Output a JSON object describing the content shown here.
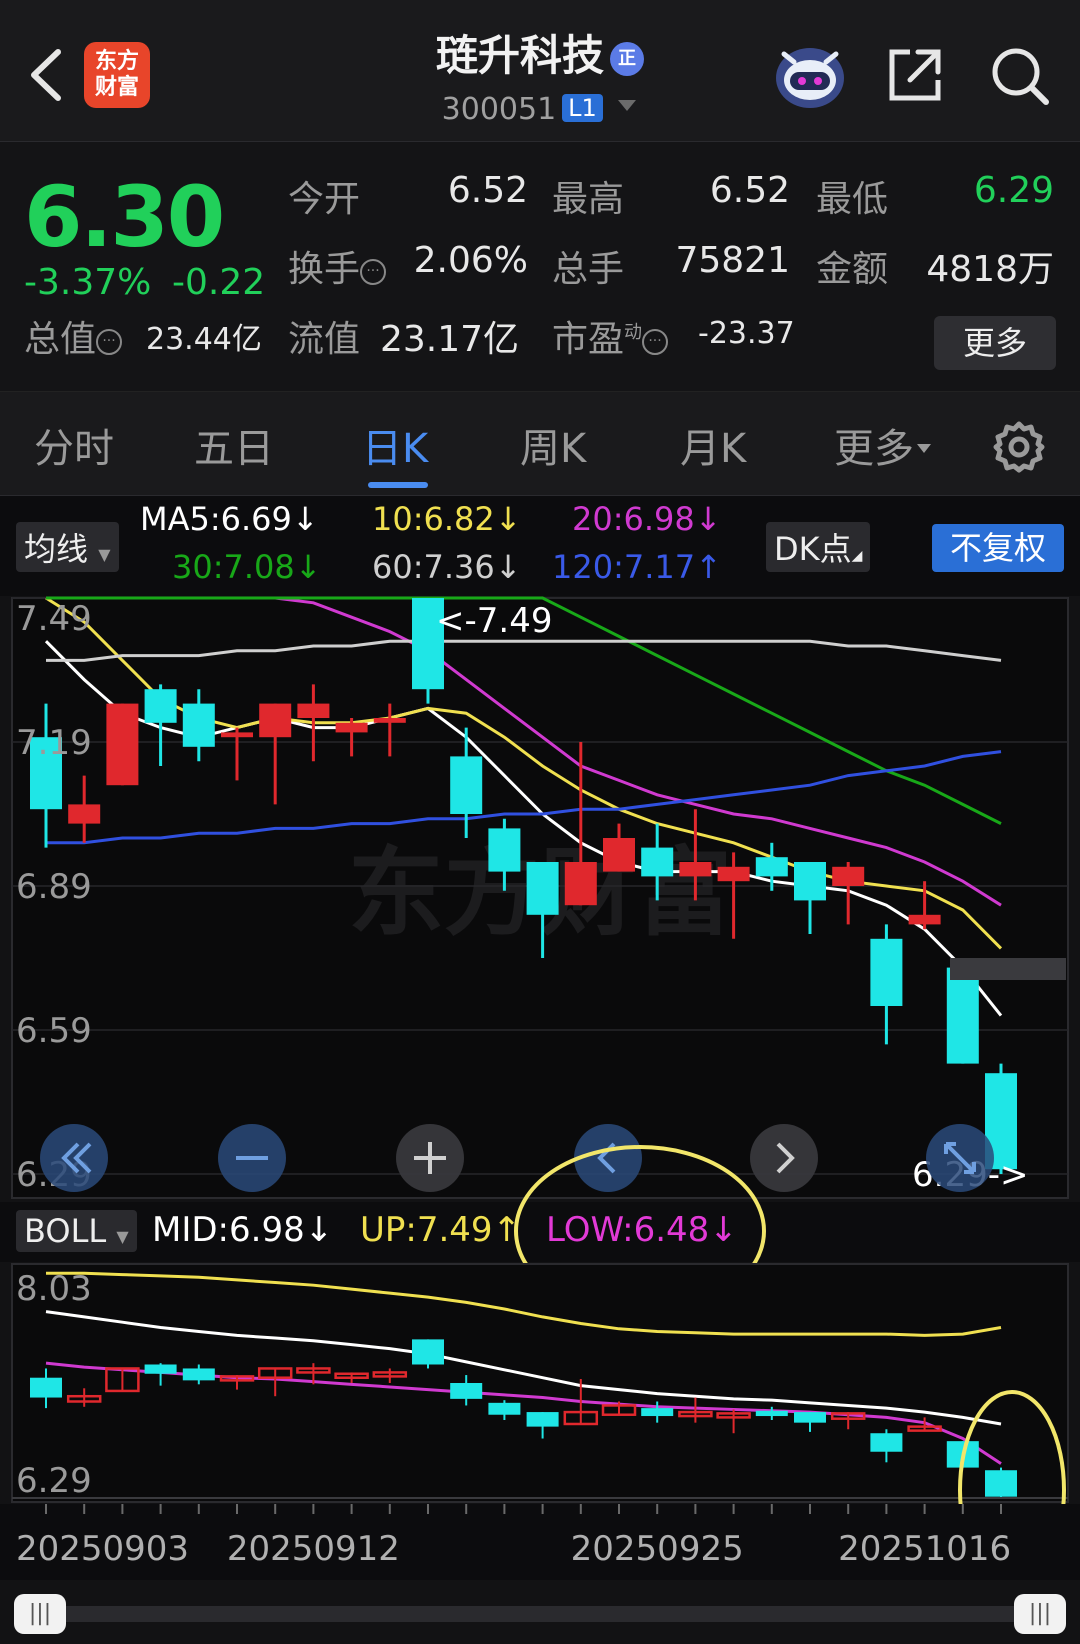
{
  "header": {
    "title": "琏升科技",
    "title_badge": "正",
    "code": "300051",
    "level": "L1",
    "logo_line1": "东方",
    "logo_line2": "财富"
  },
  "quote": {
    "price": "6.30",
    "change_pct": "-3.37%",
    "change_abs": "-0.22",
    "open_label": "今开",
    "open": "6.52",
    "high_label": "最高",
    "high": "6.52",
    "low_label": "最低",
    "low": "6.29",
    "turnover_label": "换手",
    "turnover": "2.06%",
    "volume_label": "总手",
    "volume": "75821",
    "amount_label": "金额",
    "amount": "4818万",
    "mcap_label": "总值",
    "mcap": "23.44亿",
    "float_label": "流值",
    "float": "23.17亿",
    "pe_label": "市盈",
    "pe_sup": "动",
    "pe": "-23.37",
    "more_label": "更多"
  },
  "tabs": [
    {
      "label": "分时"
    },
    {
      "label": "五日"
    },
    {
      "label": "日K"
    },
    {
      "label": "周K"
    },
    {
      "label": "月K"
    },
    {
      "label": "更多"
    }
  ],
  "ma_legend": {
    "indicator_label": "均线",
    "ma5": "MA5:6.69",
    "ma10": "10:6.82",
    "ma20": "20:6.98",
    "ma30": "30:7.08",
    "ma60": "60:7.36",
    "ma120": "120:7.17",
    "dk_label": "DK点",
    "adjust_label": "不复权"
  },
  "boll_legend": {
    "indicator_label": "BOLL",
    "mid": "MID:6.98",
    "up": "UP:7.49",
    "low": "LOW:6.48"
  },
  "colors": {
    "up": "#e0282d",
    "down": "#1fe6e6",
    "ma5": "#ffffff",
    "ma10": "#f0e050",
    "ma20": "#d03ad0",
    "ma30": "#18a818",
    "ma60": "#cfcfcf",
    "ma120": "#3050e0",
    "accent": "#2a6fd6"
  },
  "chart_data": {
    "type": "candlestick",
    "y_ticks": [
      "7.49",
      "7.19",
      "6.89",
      "6.59",
      "6.29"
    ],
    "ylim": [
      6.29,
      7.49
    ],
    "max_marker": "<-7.49",
    "min_marker": "6.29->",
    "watermark": "东方财富",
    "candles": [
      {
        "o": 7.2,
        "c": 7.05,
        "h": 7.27,
        "l": 6.97
      },
      {
        "o": 7.02,
        "c": 7.06,
        "h": 7.12,
        "l": 6.98
      },
      {
        "o": 7.1,
        "c": 7.27,
        "h": 7.27,
        "l": 7.1
      },
      {
        "o": 7.3,
        "c": 7.23,
        "h": 7.31,
        "l": 7.14
      },
      {
        "o": 7.27,
        "c": 7.18,
        "h": 7.3,
        "l": 7.15
      },
      {
        "o": 7.2,
        "c": 7.21,
        "h": 7.22,
        "l": 7.11
      },
      {
        "o": 7.2,
        "c": 7.27,
        "h": 7.27,
        "l": 7.06
      },
      {
        "o": 7.24,
        "c": 7.27,
        "h": 7.31,
        "l": 7.15
      },
      {
        "o": 7.21,
        "c": 7.23,
        "h": 7.24,
        "l": 7.16
      },
      {
        "o": 7.23,
        "c": 7.24,
        "h": 7.27,
        "l": 7.16
      },
      {
        "o": 7.49,
        "c": 7.3,
        "h": 7.49,
        "l": 7.27
      },
      {
        "o": 7.16,
        "c": 7.04,
        "h": 7.22,
        "l": 6.99
      },
      {
        "o": 7.01,
        "c": 6.92,
        "h": 7.03,
        "l": 6.88
      },
      {
        "o": 6.94,
        "c": 6.83,
        "h": 6.94,
        "l": 6.74
      },
      {
        "o": 6.85,
        "c": 6.94,
        "h": 7.19,
        "l": 6.85
      },
      {
        "o": 6.92,
        "c": 6.99,
        "h": 7.02,
        "l": 6.92
      },
      {
        "o": 6.97,
        "c": 6.91,
        "h": 7.02,
        "l": 6.86
      },
      {
        "o": 6.91,
        "c": 6.94,
        "h": 7.05,
        "l": 6.86
      },
      {
        "o": 6.9,
        "c": 6.93,
        "h": 6.96,
        "l": 6.78
      },
      {
        "o": 6.95,
        "c": 6.91,
        "h": 6.98,
        "l": 6.88
      },
      {
        "o": 6.94,
        "c": 6.86,
        "h": 6.94,
        "l": 6.79
      },
      {
        "o": 6.89,
        "c": 6.93,
        "h": 6.94,
        "l": 6.81
      },
      {
        "o": 6.78,
        "c": 6.64,
        "h": 6.81,
        "l": 6.56
      },
      {
        "o": 6.81,
        "c": 6.83,
        "h": 6.9,
        "l": 6.8
      },
      {
        "o": 6.72,
        "c": 6.52,
        "h": 6.72,
        "l": 6.52
      },
      {
        "o": 6.5,
        "c": 6.3,
        "h": 6.52,
        "l": 6.29
      }
    ],
    "series": [
      {
        "name": "MA5",
        "values": [
          7.4,
          7.32,
          7.25,
          7.22,
          7.2,
          7.22,
          7.24,
          7.22,
          7.22,
          7.24,
          7.26,
          7.2,
          7.12,
          7.04,
          6.98,
          6.94,
          6.92,
          6.92,
          6.92,
          6.9,
          6.89,
          6.88,
          6.85,
          6.8,
          6.72,
          6.62
        ]
      },
      {
        "name": "10",
        "values": [
          7.5,
          7.44,
          7.36,
          7.28,
          7.24,
          7.22,
          7.24,
          7.23,
          7.23,
          7.24,
          7.26,
          7.25,
          7.2,
          7.14,
          7.09,
          7.05,
          7.02,
          7.0,
          6.98,
          6.95,
          6.92,
          6.9,
          6.89,
          6.88,
          6.84,
          6.76
        ]
      },
      {
        "name": "20",
        "values": [
          7.7,
          7.66,
          7.62,
          7.58,
          7.55,
          7.52,
          7.5,
          7.48,
          7.45,
          7.42,
          7.38,
          7.32,
          7.26,
          7.2,
          7.14,
          7.11,
          7.08,
          7.06,
          7.04,
          7.03,
          7.01,
          6.99,
          6.97,
          6.94,
          6.9,
          6.85
        ]
      },
      {
        "name": "30",
        "values": [
          7.8,
          7.78,
          7.76,
          7.74,
          7.72,
          7.7,
          7.68,
          7.66,
          7.64,
          7.62,
          7.6,
          7.57,
          7.53,
          7.49,
          7.45,
          7.41,
          7.37,
          7.33,
          7.29,
          7.25,
          7.21,
          7.17,
          7.13,
          7.1,
          7.06,
          7.02
        ]
      },
      {
        "name": "60",
        "values": [
          7.36,
          7.36,
          7.37,
          7.37,
          7.37,
          7.38,
          7.38,
          7.39,
          7.39,
          7.4,
          7.4,
          7.4,
          7.4,
          7.4,
          7.4,
          7.4,
          7.4,
          7.4,
          7.4,
          7.4,
          7.4,
          7.39,
          7.39,
          7.38,
          7.37,
          7.36
        ]
      },
      {
        "name": "120",
        "values": [
          6.98,
          6.98,
          6.99,
          6.99,
          7.0,
          7.0,
          7.01,
          7.01,
          7.02,
          7.02,
          7.03,
          7.03,
          7.04,
          7.04,
          7.05,
          7.05,
          7.06,
          7.07,
          7.08,
          7.09,
          7.1,
          7.12,
          7.13,
          7.14,
          7.16,
          7.17
        ]
      }
    ],
    "boll": {
      "y_ticks": [
        "8.03",
        "6.29"
      ],
      "ylim": [
        6.29,
        8.03
      ],
      "up": [
        7.99,
        7.99,
        7.98,
        7.97,
        7.96,
        7.94,
        7.92,
        7.9,
        7.87,
        7.84,
        7.81,
        7.77,
        7.72,
        7.66,
        7.61,
        7.57,
        7.55,
        7.54,
        7.53,
        7.53,
        7.53,
        7.53,
        7.53,
        7.52,
        7.53,
        7.58
      ],
      "mid": [
        7.7,
        7.66,
        7.62,
        7.58,
        7.55,
        7.52,
        7.5,
        7.48,
        7.45,
        7.42,
        7.38,
        7.32,
        7.26,
        7.2,
        7.14,
        7.11,
        7.08,
        7.06,
        7.04,
        7.03,
        7.01,
        6.99,
        6.97,
        6.94,
        6.9,
        6.85
      ],
      "low": [
        7.31,
        7.28,
        7.26,
        7.24,
        7.22,
        7.2,
        7.19,
        7.17,
        7.15,
        7.13,
        7.11,
        7.09,
        7.07,
        7.05,
        7.02,
        7.0,
        6.98,
        6.97,
        6.96,
        6.95,
        6.94,
        6.92,
        6.9,
        6.86,
        6.74,
        6.55
      ]
    },
    "x_labels": [
      {
        "label": "20250903",
        "index": 1
      },
      {
        "label": "20250912",
        "index": 7
      },
      {
        "label": "20250925",
        "index": 16
      },
      {
        "label": "20251016",
        "index": 23
      }
    ]
  }
}
